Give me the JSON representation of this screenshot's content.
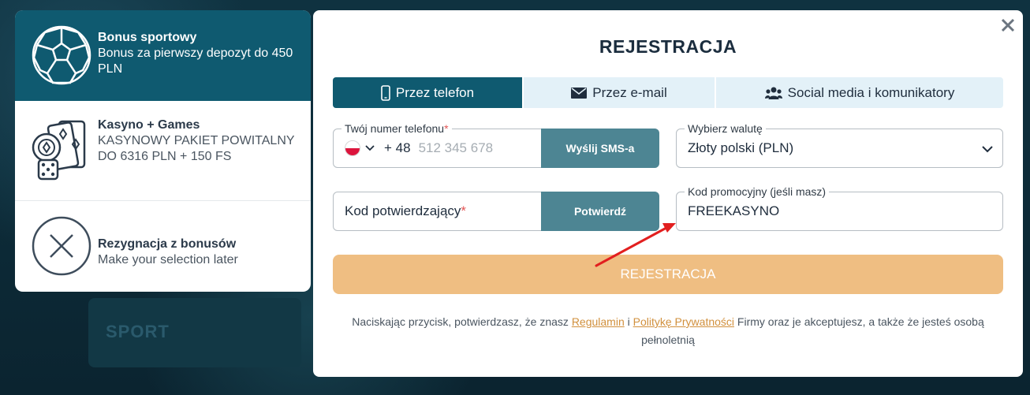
{
  "background": {
    "sport_label": "SPORT"
  },
  "bonuses": [
    {
      "title": "Bonus sportowy",
      "description": "Bonus za pierwszy depozyt do 450 PLN",
      "icon": "soccer-ball-icon",
      "selected": true
    },
    {
      "title": "Kasyno + Games",
      "description": "KASYNOWY PAKIET POWITALNY DO 6316 PLN + 150 FS",
      "icon": "casino-icon",
      "selected": false
    },
    {
      "title": "Rezygnacja z bonusów",
      "description": "Make your selection later",
      "icon": "close-circle-icon",
      "selected": false
    }
  ],
  "modal": {
    "title": "REJESTRACJA",
    "close_icon": "close-icon",
    "tabs": [
      {
        "label": "Przez telefon",
        "icon": "phone-icon",
        "active": true
      },
      {
        "label": "Przez e-mail",
        "icon": "envelope-icon",
        "active": false
      },
      {
        "label": "Social media i komunikatory",
        "icon": "users-icon",
        "active": false
      }
    ],
    "phone": {
      "label": "Twój numer telefonu",
      "required_mark": "*",
      "prefix": "+ 48",
      "placeholder": "512 345 678",
      "button": "Wyślij SMS-a"
    },
    "currency": {
      "label": "Wybierz walutę",
      "value": "Złoty polski (PLN)"
    },
    "code": {
      "placeholder": "Kod potwierdzający",
      "required_mark": "*",
      "button": "Potwierdź"
    },
    "promo": {
      "label": "Kod promocyjny (jeśli masz)",
      "value": "FREEKASYNO"
    },
    "register_button": "REJESTRACJA",
    "legal": {
      "before": "Naciskając przycisk, potwierdzasz, że znasz ",
      "terms_link": "Regulamin",
      "middle": " i ",
      "privacy_link": "Politykę Prywatności",
      "after": " Firmy oraz je akceptujesz, a także że jesteś osobą pełnoletnią"
    }
  },
  "colors": {
    "accent": "#0f5a70",
    "button_secondary": "#4d8593",
    "register": "#efbe82",
    "link": "#d1903d",
    "arrow": "#e21f1f"
  }
}
